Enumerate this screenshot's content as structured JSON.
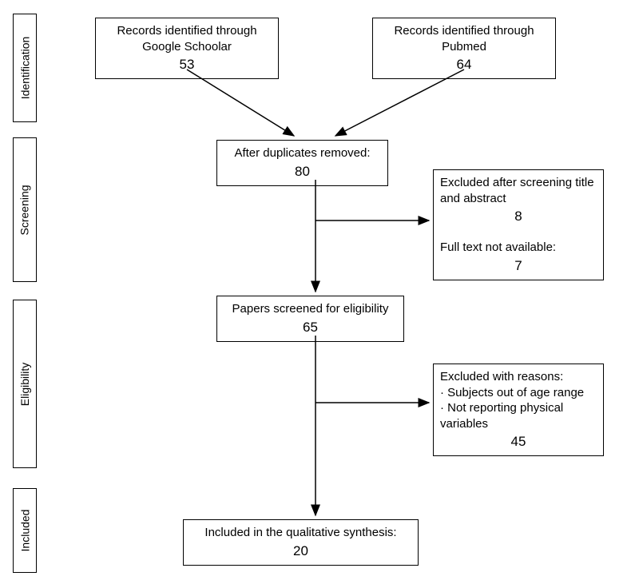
{
  "stages": {
    "identification": "Identification",
    "screening": "Screening",
    "eligibility": "Eligibility",
    "included": "Included"
  },
  "boxes": {
    "google": {
      "label": "Records identified through Google Schoolar",
      "value": "53"
    },
    "pubmed": {
      "label": "Records identified through Pubmed",
      "value": "64"
    },
    "dedup": {
      "label": "After duplicates removed:",
      "value": "80"
    },
    "screen_exclude": {
      "label1": "Excluded after screening title and abstract",
      "value1": "8",
      "label2": "Full text not available:",
      "value2": "7"
    },
    "eligibility_box": {
      "label": "Papers screened for eligibility",
      "value": "65"
    },
    "elig_exclude": {
      "label": "Excluded with reasons:",
      "reason1": "Subjects out of age range",
      "reason2": "Not reporting physical variables",
      "value": "45"
    },
    "included_box": {
      "label": "Included in the qualitative synthesis:",
      "value": "20"
    }
  }
}
